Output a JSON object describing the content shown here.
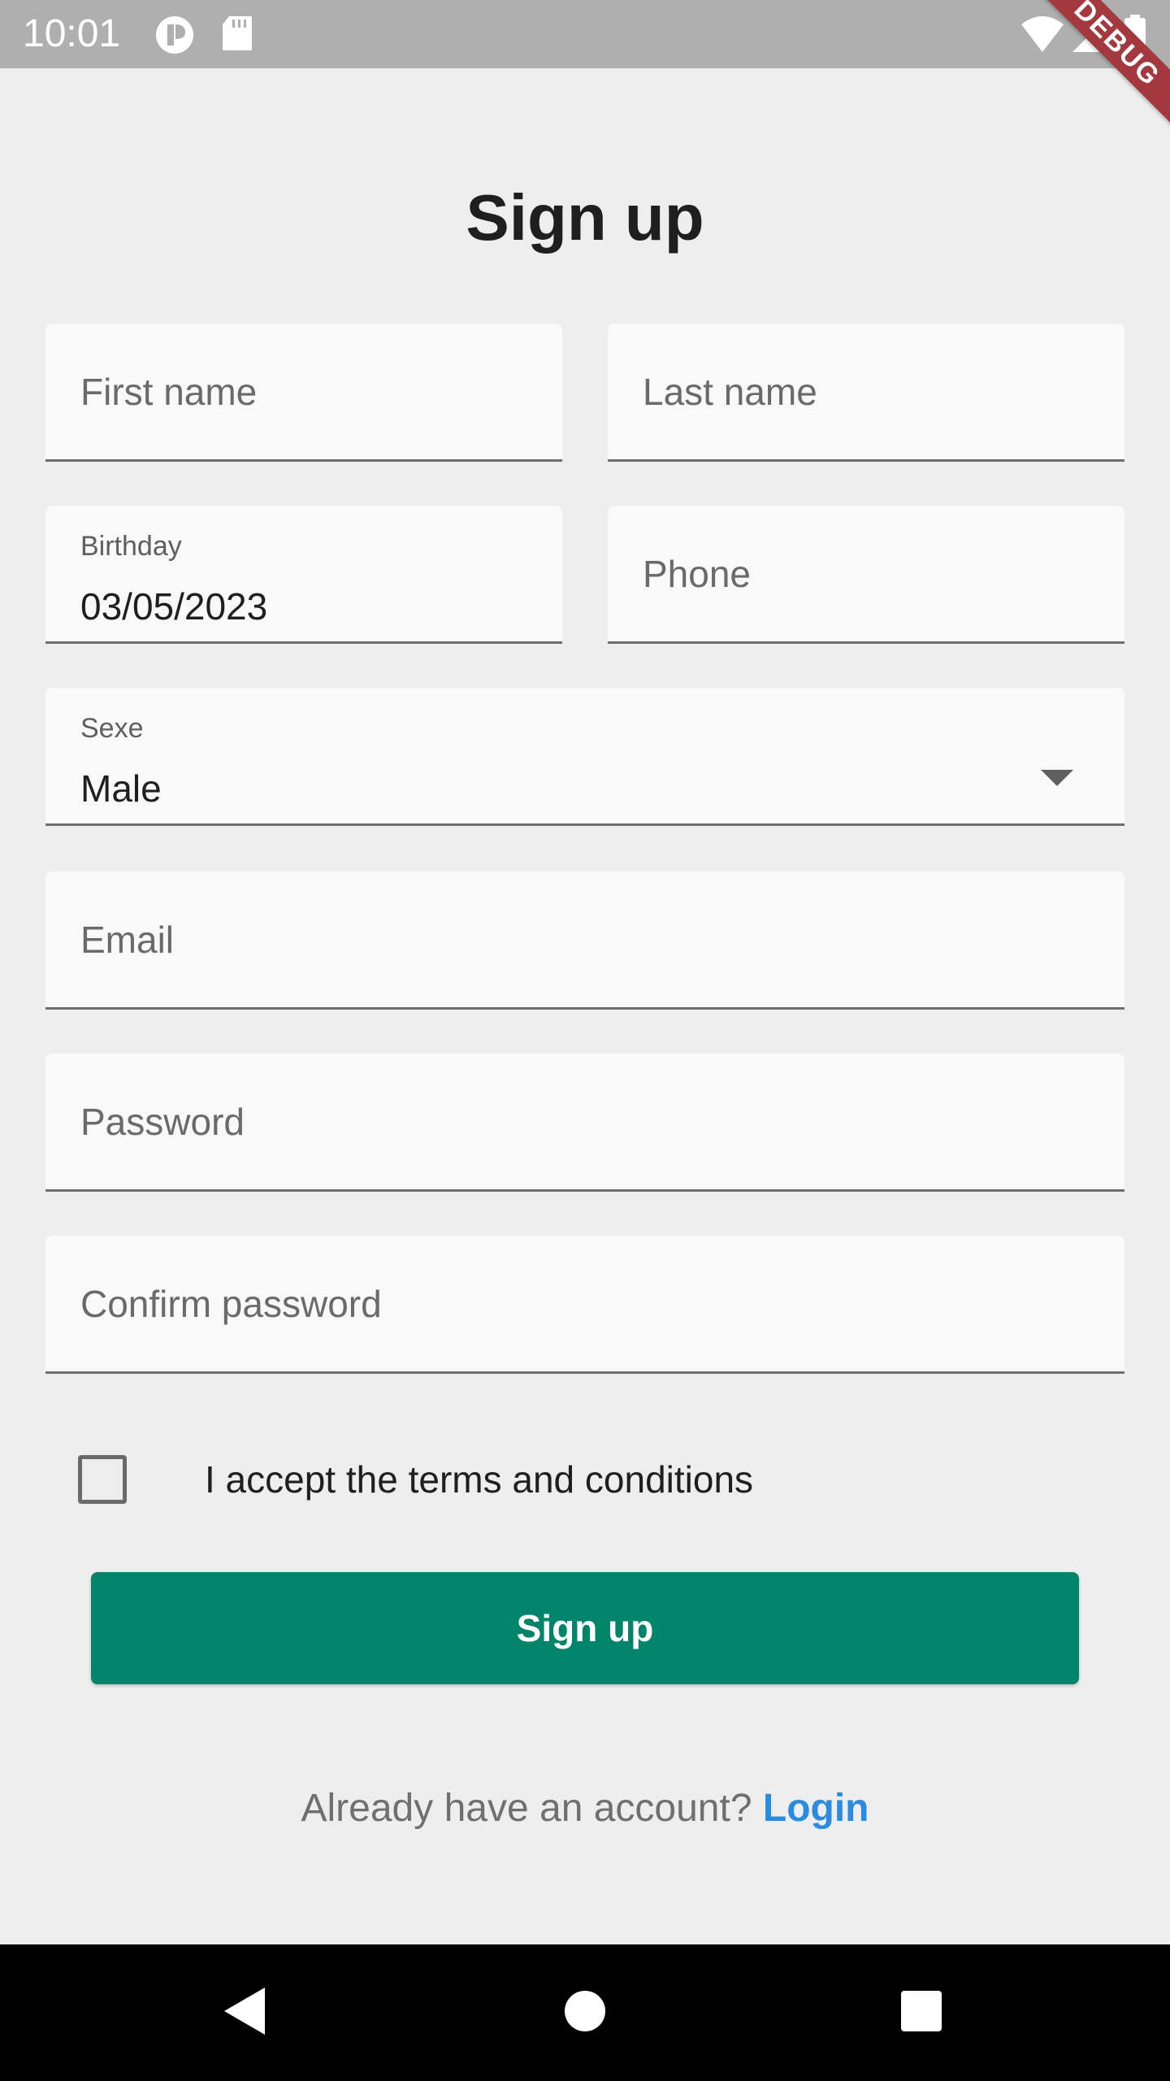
{
  "status_bar": {
    "time": "10:01",
    "left_icons": [
      "data-saver-icon",
      "sd-card-icon"
    ],
    "right_icons": [
      "wifi-icon",
      "cell-signal-icon",
      "battery-icon"
    ]
  },
  "debug_banner": "DEBUG",
  "title": "Sign up",
  "fields": {
    "first_name": {
      "placeholder": "First name"
    },
    "last_name": {
      "placeholder": "Last name"
    },
    "birthday": {
      "label": "Birthday",
      "value": "03/05/2023"
    },
    "phone": {
      "placeholder": "Phone"
    },
    "sexe": {
      "label": "Sexe",
      "value": "Male"
    },
    "email": {
      "placeholder": "Email"
    },
    "password": {
      "placeholder": "Password"
    },
    "confirm_password": {
      "placeholder": "Confirm password"
    }
  },
  "terms": {
    "label": "I accept the terms and conditions",
    "checked": false
  },
  "signup_button": "Sign up",
  "footer": {
    "question": "Already have an account?",
    "login_link": "Login"
  },
  "nav": {
    "icons": [
      "back-icon",
      "home-icon",
      "recents-icon"
    ]
  },
  "colors": {
    "primary_button": "#00856a",
    "link": "#2a8be0",
    "background": "#eeeeee",
    "field_fill": "#f9f9f9",
    "debug_banner": "#a3383f"
  }
}
